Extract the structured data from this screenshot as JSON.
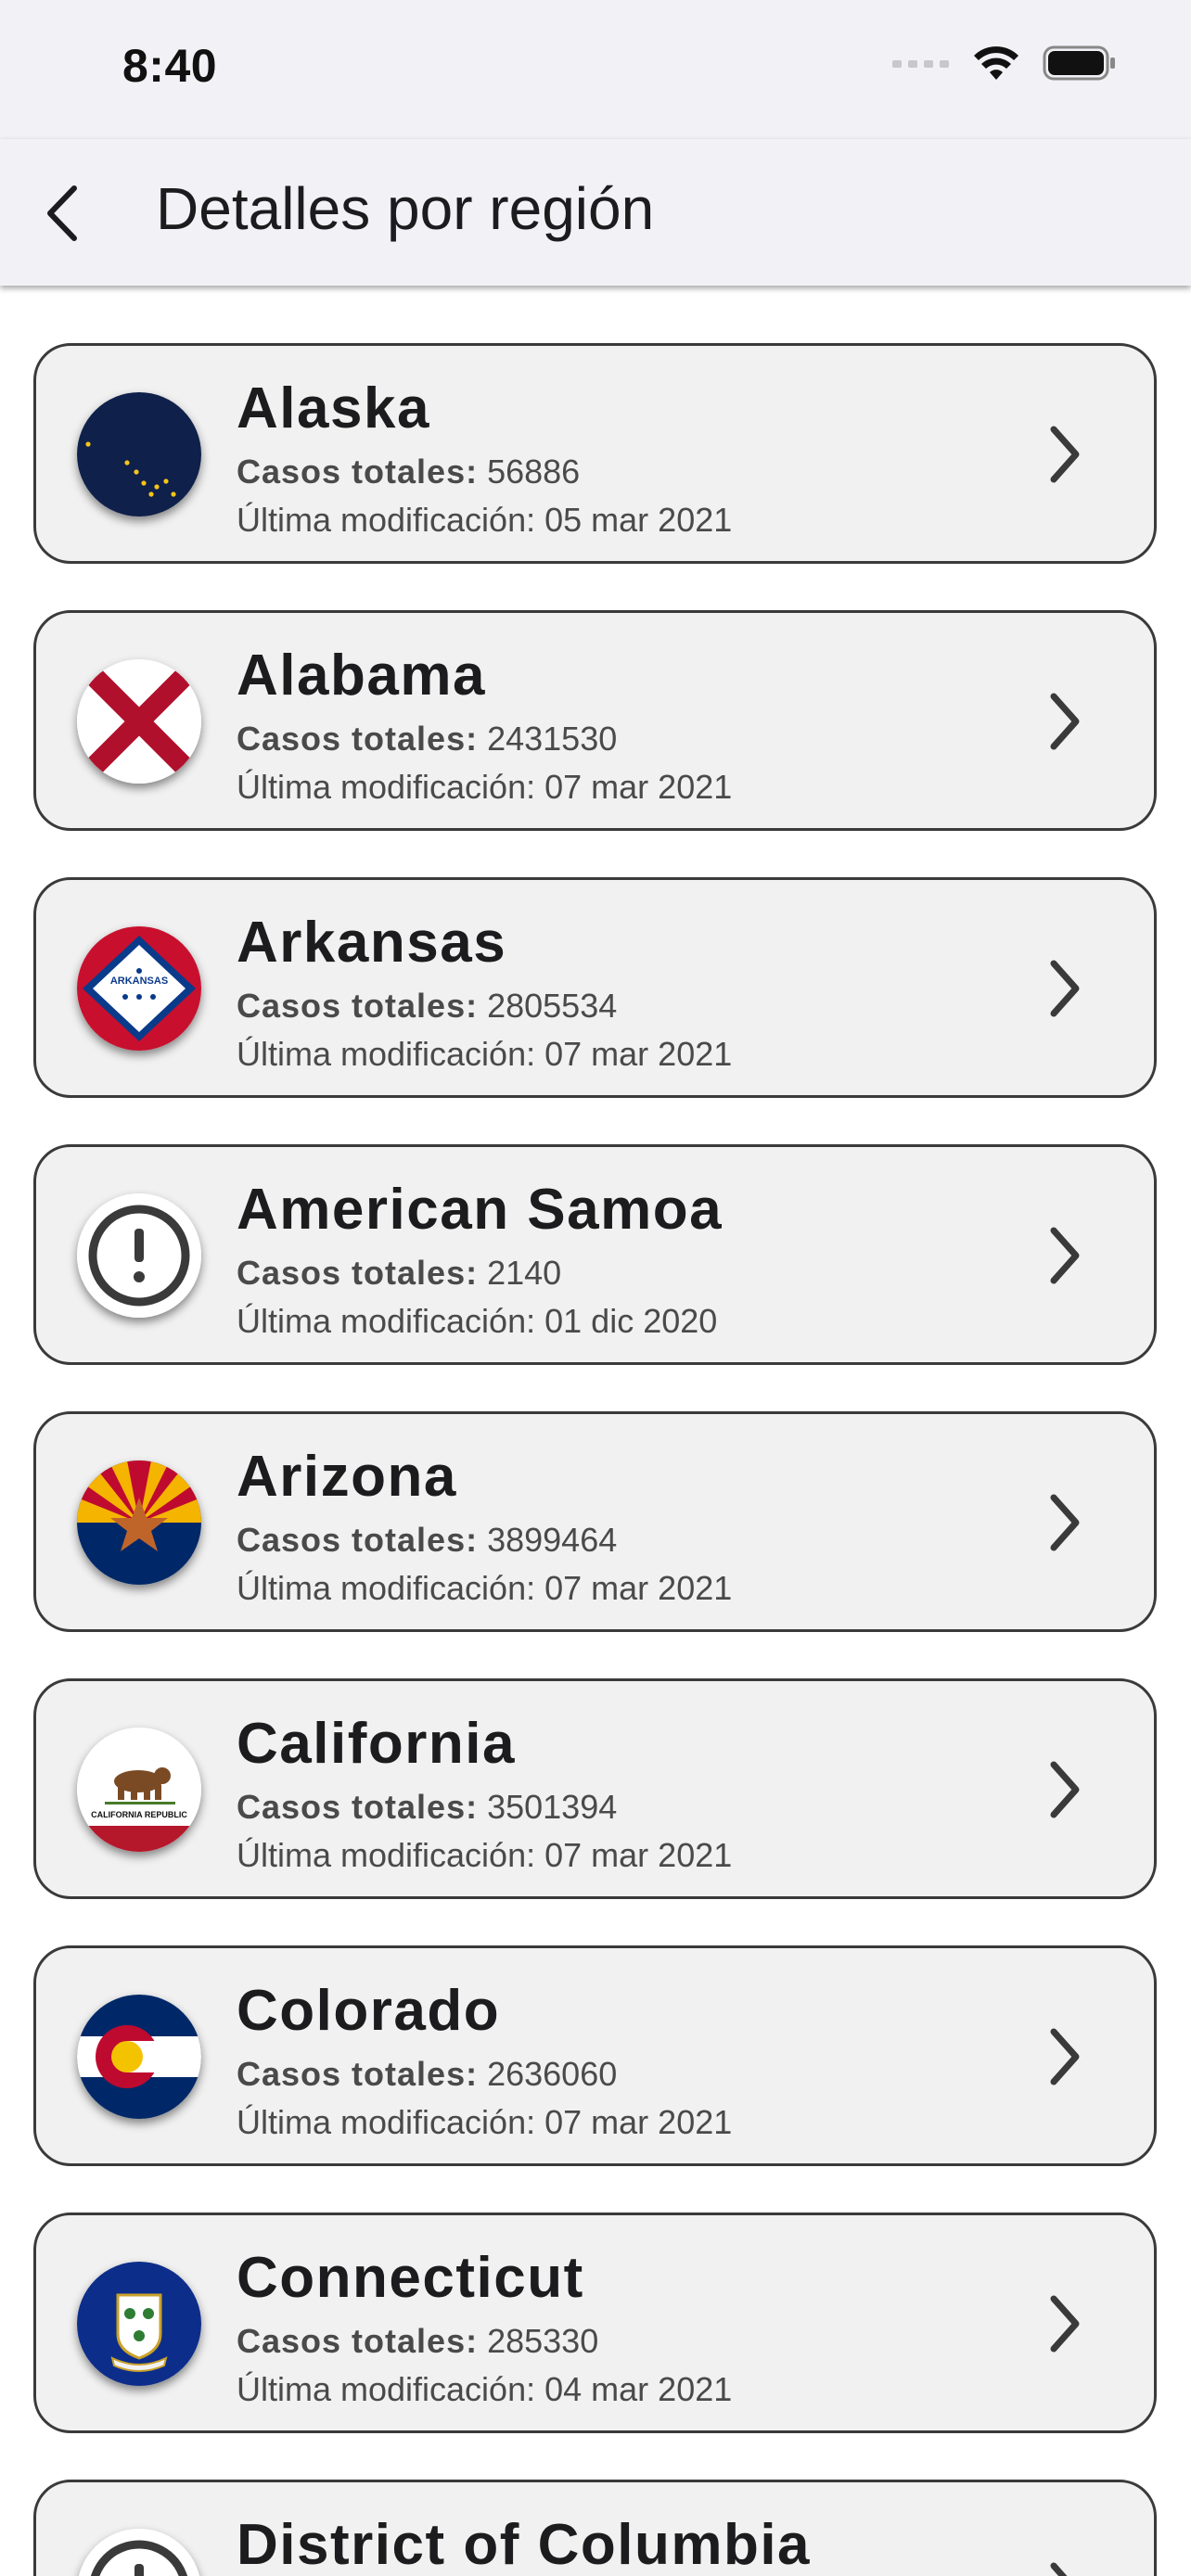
{
  "status_bar": {
    "time": "8:40",
    "signal_icon": "signal-dots-icon",
    "wifi_icon": "wifi-icon",
    "battery_icon": "battery-icon"
  },
  "nav": {
    "back_icon": "chevron-left-icon",
    "title": "Detalles por región"
  },
  "labels": {
    "cases_label": "Casos totales:",
    "modified_prefix": "Última modificación:"
  },
  "regions": [
    {
      "name": "Alaska",
      "cases": "56886",
      "modified": "05 mar 2021",
      "flag": "alaska-flag-icon"
    },
    {
      "name": "Alabama",
      "cases": "2431530",
      "modified": "07 mar 2021",
      "flag": "alabama-flag-icon"
    },
    {
      "name": "Arkansas",
      "cases": "2805534",
      "modified": "07 mar 2021",
      "flag": "arkansas-flag-icon",
      "flag_text": "ARKANSAS"
    },
    {
      "name": "American Samoa",
      "cases": "2140",
      "modified": "01 dic 2020",
      "flag": "alert-icon"
    },
    {
      "name": "Arizona",
      "cases": "3899464",
      "modified": "07 mar 2021",
      "flag": "arizona-flag-icon"
    },
    {
      "name": "California",
      "cases": "3501394",
      "modified": "07 mar 2021",
      "flag": "california-flag-icon",
      "flag_text": "CALIFORNIA REPUBLIC"
    },
    {
      "name": "Colorado",
      "cases": "2636060",
      "modified": "07 mar 2021",
      "flag": "colorado-flag-icon"
    },
    {
      "name": "Connecticut",
      "cases": "285330",
      "modified": "04 mar 2021",
      "flag": "connecticut-flag-icon"
    },
    {
      "name": "District of Columbia",
      "cases": "",
      "modified": "",
      "flag": "alert-icon"
    }
  ],
  "colors": {
    "card_bg": "#f1f1f1",
    "card_border": "#3a3a3a",
    "nav_bg": "#f2f2f6",
    "text_primary": "#1c1c1e",
    "text_secondary": "#4a4a4a"
  }
}
